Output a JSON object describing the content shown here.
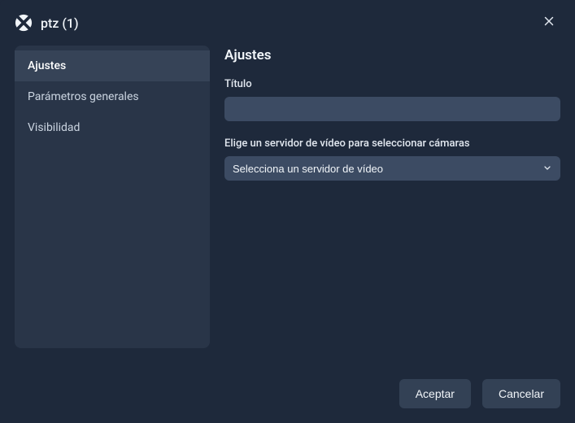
{
  "header": {
    "title": "ptz (1)"
  },
  "sidebar": {
    "items": [
      {
        "label": "Ajustes",
        "active": true
      },
      {
        "label": "Parámetros generales",
        "active": false
      },
      {
        "label": "Visibilidad",
        "active": false
      }
    ]
  },
  "content": {
    "heading": "Ajustes",
    "title_label": "Título",
    "title_value": "",
    "server_label": "Elige un servidor de vídeo para seleccionar cámaras",
    "server_placeholder": "Selecciona un servidor de vídeo"
  },
  "footer": {
    "accept": "Aceptar",
    "cancel": "Cancelar"
  }
}
